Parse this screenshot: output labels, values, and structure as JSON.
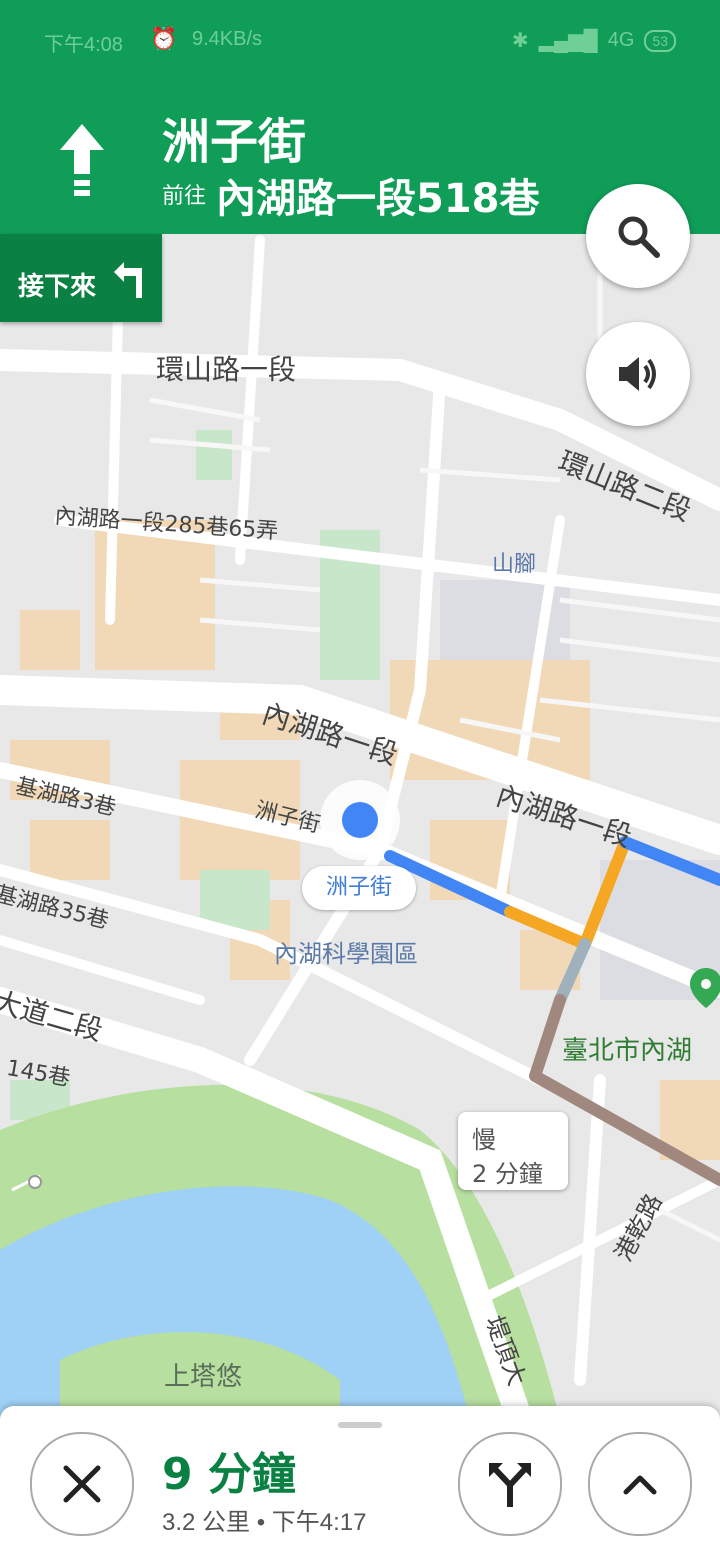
{
  "status_bar": {
    "time": "下午4:08",
    "speed": "9.4KB/s",
    "network": "4G",
    "battery": "53"
  },
  "nav": {
    "street": "洲子街",
    "toward_prefix": "前往",
    "destination": "內湖路一段518巷",
    "next_label": "接下來"
  },
  "map_labels": {
    "huanshan_1": "環山路一段",
    "huanshan_2": "環山路二段",
    "neihu_285": "內湖路一段285巷65弄",
    "shanjiao": "山腳",
    "neihu_1": "內湖路一段",
    "neihu_1b": "內湖路一段",
    "jihu_3": "基湖路3巷",
    "zhouzi": "洲子街",
    "jihu_35": "基湖路35巷",
    "park": "內湖科學園區",
    "dadao": "大道二段",
    "lane145": "145巷",
    "taipei_neihu": "臺北市內湖",
    "gangqian": "港乾路",
    "shangtayou": "上塔悠",
    "diding": "堤頂大"
  },
  "current_location": {
    "label": "洲子街"
  },
  "traffic_callout": {
    "status": "慢",
    "time": "2 分鐘"
  },
  "trip": {
    "eta": "9 分鐘",
    "distance": "3.2 公里",
    "arrival": "下午4:17"
  },
  "colors": {
    "nav_green": "#0f9d58",
    "next_green": "#0b8043",
    "route_blue": "#4285f4",
    "route_orange": "#f5a623",
    "route_brown": "#a1887f"
  },
  "icons": [
    "straight-arrow-icon",
    "turn-left-icon",
    "search-icon",
    "volume-icon",
    "close-icon",
    "alternate-routes-icon",
    "chevron-up-icon",
    "map-pin-icon"
  ]
}
